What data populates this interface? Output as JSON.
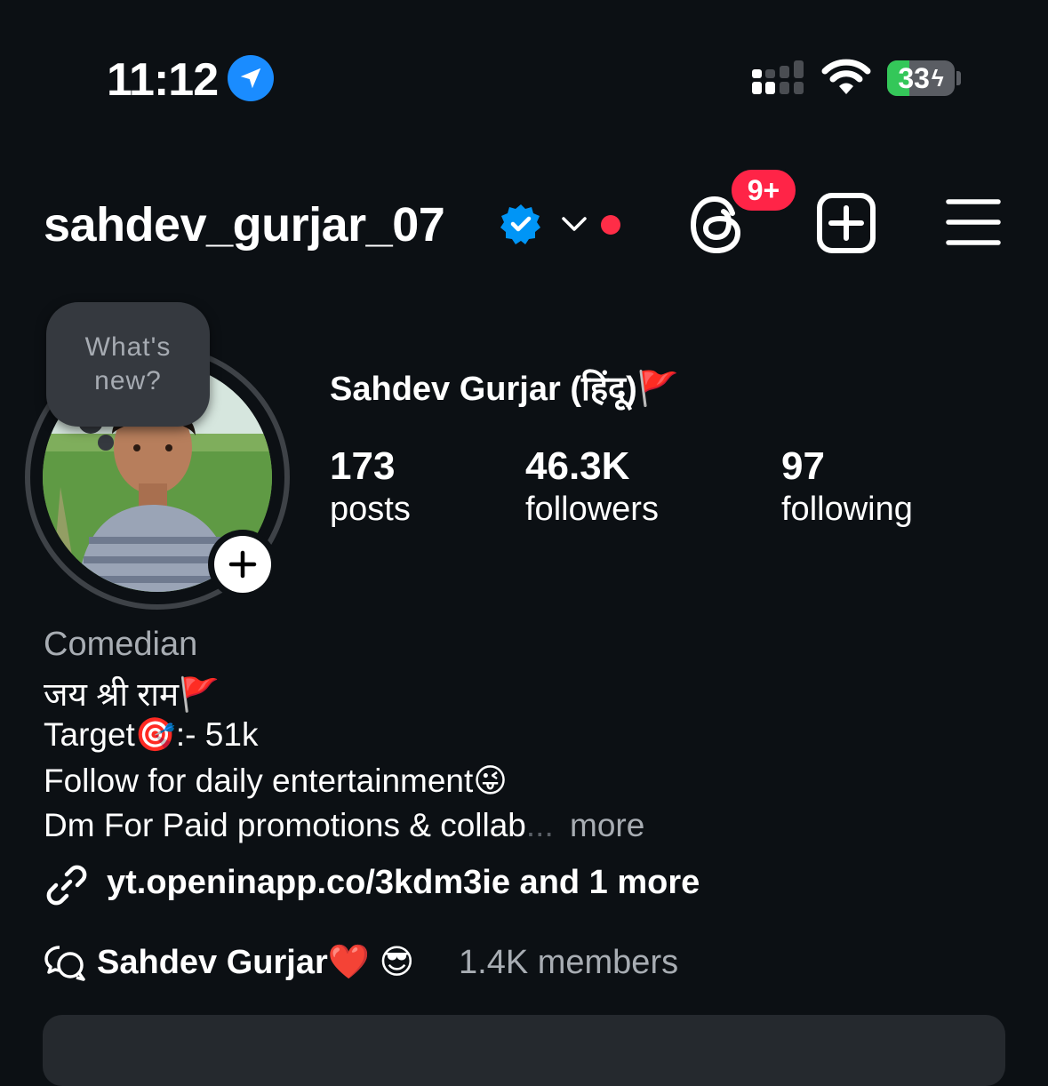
{
  "status_bar": {
    "time": "11:12",
    "battery": "33",
    "battery_level": 0.33,
    "location_icon": "location-arrow-icon",
    "signal_icon": "cellular-signal-icon",
    "wifi_icon": "wifi-icon"
  },
  "header": {
    "username": "sahdev_gurjar_07",
    "verified_icon": "verified-badge-icon",
    "threads_badge": "9+",
    "threads_icon": "threads-icon",
    "new_post_icon": "plus-square-icon",
    "menu_icon": "hamburger-menu-icon"
  },
  "profile": {
    "note_bubble": "What's\nnew?",
    "full_name": "Sahdev Gurjar (हिंदू)🚩",
    "stats": [
      {
        "value": "173",
        "label": "posts"
      },
      {
        "value": "46.3K",
        "label": "followers"
      },
      {
        "value": "97",
        "label": "following"
      }
    ]
  },
  "bio": {
    "category": "Comedian",
    "lines": [
      "जय श्री राम🚩",
      "Target🎯:- 51k",
      "Follow for daily entertainment😜",
      "Dm For Paid promotions & collab"
    ],
    "ellipsis": "...",
    "more": "more",
    "link": "yt.openinapp.co/3kdm3ie and 1 more",
    "channel_name": "Sahdev Gurjar❤️ 😎",
    "channel_members": "1.4K members"
  },
  "colors": {
    "background": "#0c1014",
    "accent_blue": "#1a8cff",
    "badge_red": "#ff2447",
    "battery_green": "#34c759",
    "muted_text": "#a8adb3"
  }
}
